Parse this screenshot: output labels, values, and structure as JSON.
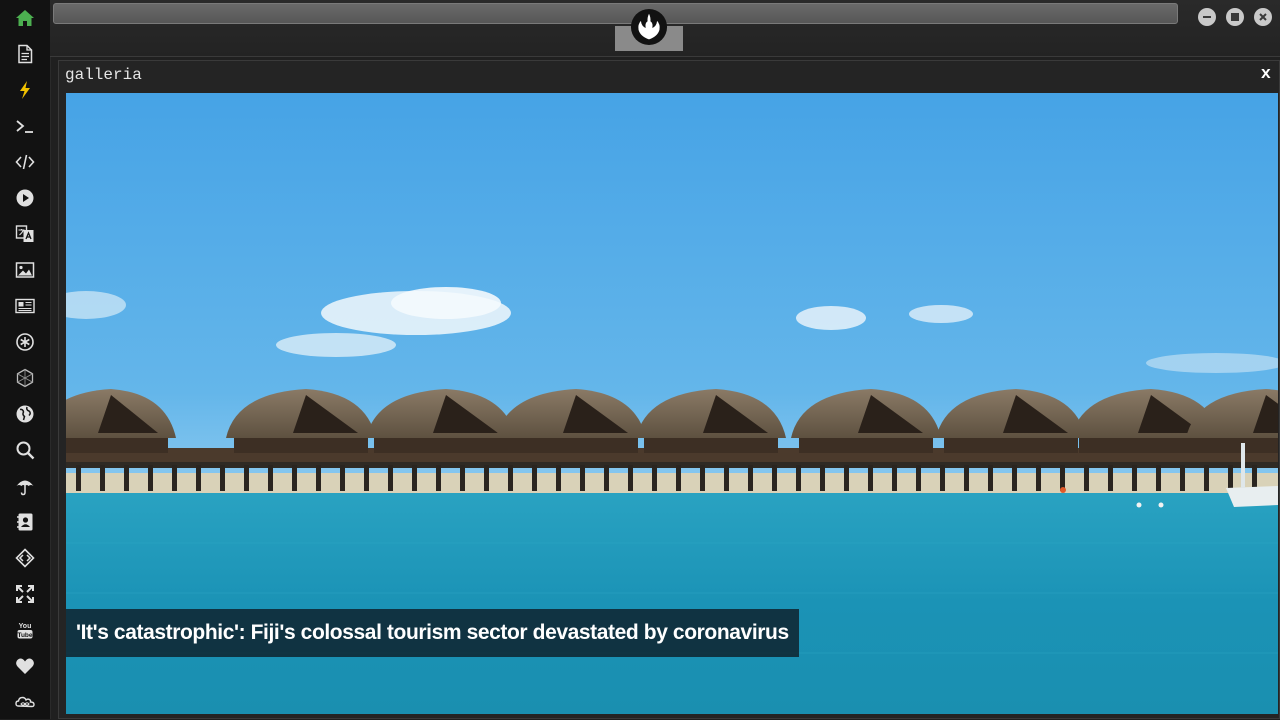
{
  "window": {
    "title": "galleria",
    "close_label": "x"
  },
  "gallery": {
    "caption": "'It's catastrophic': Fiji's colossal tourism sector devastated by coronavirus"
  },
  "dock": {
    "items": [
      {
        "icon": "home-icon",
        "color": "#4caf50"
      },
      {
        "icon": "document-icon"
      },
      {
        "icon": "lightning-icon",
        "color": "#f2c200"
      },
      {
        "icon": "terminal-icon"
      },
      {
        "icon": "code-icon"
      },
      {
        "icon": "play-icon"
      },
      {
        "icon": "translate-icon"
      },
      {
        "icon": "image-icon"
      },
      {
        "icon": "newspaper-icon"
      },
      {
        "icon": "asterisk-badge-icon"
      },
      {
        "icon": "hexagon-icon"
      },
      {
        "icon": "globe-icon"
      },
      {
        "icon": "search-icon"
      },
      {
        "icon": "umbrella-icon"
      },
      {
        "icon": "contact-book-icon"
      },
      {
        "icon": "diamond-code-icon"
      },
      {
        "icon": "fullscreen-icon"
      },
      {
        "icon": "youtube-icon"
      },
      {
        "icon": "heart-icon"
      },
      {
        "icon": "infinity-cloud-icon"
      }
    ]
  },
  "colors": {
    "dock_bg": "#121212",
    "accent_green": "#4caf50",
    "accent_yellow": "#f2c200",
    "sky": "#4aa6e4",
    "sea": "#1f98b8"
  }
}
